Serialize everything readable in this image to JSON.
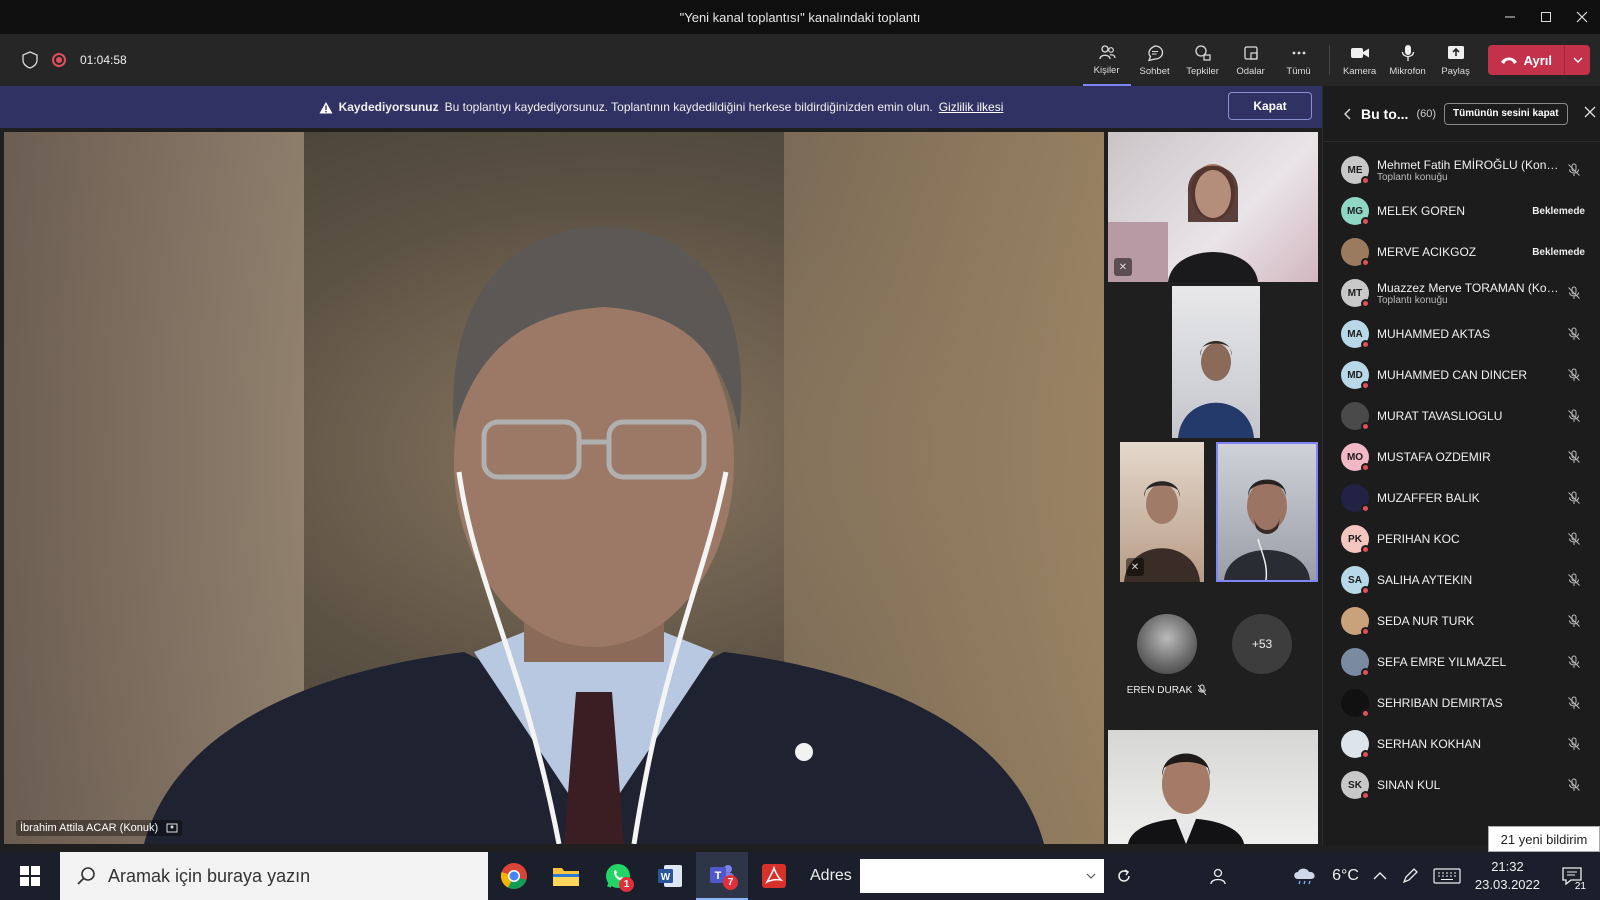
{
  "window": {
    "title": "\"Yeni kanal toplantısı\" kanalındaki toplantı",
    "controls": [
      "minimize",
      "maximize",
      "close"
    ]
  },
  "toolbar": {
    "timer": "01:04:58",
    "buttons": [
      {
        "label": "Kişiler",
        "icon": "people-icon",
        "active": true
      },
      {
        "label": "Sohbet",
        "icon": "chat-icon"
      },
      {
        "label": "Tepkiler",
        "icon": "reactions-icon"
      },
      {
        "label": "Odalar",
        "icon": "rooms-icon"
      },
      {
        "label": "Tümü",
        "icon": "more-icon"
      },
      {
        "label": "Kamera",
        "icon": "camera-icon"
      },
      {
        "label": "Mikrofon",
        "icon": "microphone-icon"
      },
      {
        "label": "Paylaş",
        "icon": "share-icon"
      }
    ],
    "leave_label": "Ayrıl",
    "leave_color": "#c4314b"
  },
  "banner": {
    "title": "Kaydediyorsunuz",
    "message": "Bu toplantıyı kaydediyorsunuz. Toplantının kaydedildiğini herkese bildirdiğinizden emin olun.",
    "link": "Gizlilik ilkesi",
    "close_label": "Kapat",
    "bg_color": "#2f3262"
  },
  "main_video": {
    "name": "İbrahim Attila ACAR (Konuk)"
  },
  "gallery": {
    "eren_name": "EREN DURAK",
    "more_count": "+53"
  },
  "panel": {
    "title": "Bu to...",
    "count": "(60)",
    "mute_all_label": "Tümünün sesini kapat",
    "participants": [
      {
        "initials": "ME",
        "name": "Mehmet Fatih EMİROĞLU (Konuk)",
        "sub": "Toplantı konuğu",
        "color": "#c8c8c8"
      },
      {
        "initials": "MG",
        "name": "MELEK GOREN",
        "status": "Beklemede",
        "color": "#8fd6c3"
      },
      {
        "initials": "",
        "name": "MERVE ACIKGOZ",
        "status": "Beklemede",
        "color": "#9a7b5f",
        "photo": true
      },
      {
        "initials": "MT",
        "name": "Muazzez Merve TORAMAN (Kon...",
        "sub": "Toplantı konuğu",
        "color": "#c8c8c8"
      },
      {
        "initials": "MA",
        "name": "MUHAMMED AKTAS",
        "color": "#b8d8e8"
      },
      {
        "initials": "MD",
        "name": "MUHAMMED CAN DINCER",
        "color": "#b8d8e8"
      },
      {
        "initials": "",
        "name": "MURAT TAVASLIOGLU",
        "color": "#4a4a4a",
        "photo": true
      },
      {
        "initials": "MO",
        "name": "MUSTAFA OZDEMIR",
        "color": "#f2b8c6"
      },
      {
        "initials": "",
        "name": "MUZAFFER BALIK",
        "color": "#222244",
        "photo": true
      },
      {
        "initials": "PK",
        "name": "PERIHAN KOC",
        "color": "#f5c6c0"
      },
      {
        "initials": "SA",
        "name": "SALIHA AYTEKIN",
        "color": "#b8d8e8"
      },
      {
        "initials": "",
        "name": "SEDA NUR TURK",
        "color": "#c9a27c",
        "photo": true
      },
      {
        "initials": "",
        "name": "SEFA EMRE YILMAZEL",
        "color": "#7a8aa0",
        "photo": true
      },
      {
        "initials": "",
        "name": "SEHRIBAN DEMIRTAS",
        "color": "#111111",
        "photo": true
      },
      {
        "initials": "",
        "name": "SERHAN KOKHAN",
        "color": "#dde4ec",
        "photo": true
      },
      {
        "initials": "SK",
        "name": "SINAN KUL",
        "color": "#c8c8c8"
      }
    ]
  },
  "toast": "21 yeni bildirim",
  "taskbar": {
    "search_placeholder": "Aramak için buraya yazın",
    "whatsapp_badge": "1",
    "teams_badge": "7",
    "address_label": "Adres",
    "weather": "6°C",
    "time": "21:32",
    "date": "23.03.2022",
    "notifications": "21"
  }
}
